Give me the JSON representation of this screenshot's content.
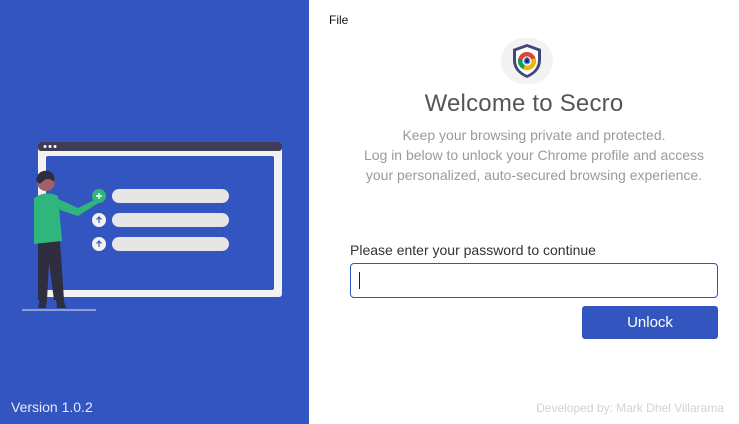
{
  "sidebar": {
    "version": "Version 1.0.2"
  },
  "menu": {
    "file_label": "File"
  },
  "main": {
    "logo_icon": "shield-chrome-icon",
    "title": "Welcome to Secro",
    "subtitle_lines": [
      "Keep your browsing private and protected.",
      "Log in below to unlock your Chrome profile and access",
      "your personalized, auto-secured browsing experience."
    ],
    "prompt": "Please enter your password to continue",
    "password_value": "",
    "unlock_label": "Unlock",
    "developer": "Developed by: Mark Dhel Villarama"
  },
  "colors": {
    "brand_blue": "#3355bf",
    "illustration_window": "#f2f2f2",
    "list_bar": "#e6e6e6",
    "accent_green": "#2fb67c"
  },
  "icons": {
    "illustration": "person-presenting-list-illustration"
  }
}
